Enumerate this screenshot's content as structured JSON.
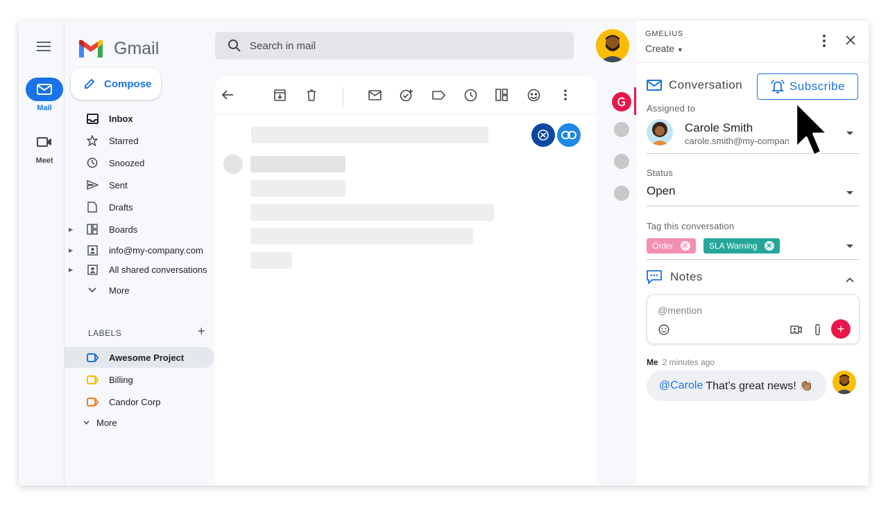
{
  "rail": {
    "mail_label": "Mail",
    "meet_label": "Meet"
  },
  "app": {
    "name": "Gmail",
    "compose_label": "Compose"
  },
  "search": {
    "placeholder": "Search in mail"
  },
  "nav": {
    "items": [
      {
        "label": "Inbox",
        "icon": "inbox-icon",
        "bold": true
      },
      {
        "label": "Starred",
        "icon": "star-icon"
      },
      {
        "label": "Snoozed",
        "icon": "clock-icon"
      },
      {
        "label": "Sent",
        "icon": "send-icon"
      },
      {
        "label": "Drafts",
        "icon": "draft-icon"
      },
      {
        "label": "Boards",
        "icon": "boards-icon"
      },
      {
        "label": "info@my-company.com",
        "icon": "shared-inbox-icon"
      },
      {
        "label": "All shared conversations",
        "icon": "shared-inbox-icon"
      },
      {
        "label": "More",
        "icon": "chevron-down-icon"
      }
    ],
    "labels_heading": "LABELS",
    "labels": [
      {
        "label": "Awesome Project",
        "color": "#1a73e8"
      },
      {
        "label": "Billing",
        "color": "#fbbc04"
      },
      {
        "label": "Candor Corp",
        "color": "#fa7b17"
      }
    ],
    "labels_more": "More"
  },
  "panel": {
    "brand": "GMELIUS",
    "create_label": "Create",
    "conversation_title": "Conversation",
    "subscribe_label": "Subscribe",
    "assigned_label": "Assigned to",
    "assignee_name": "Carole Smith",
    "assignee_email": "carole.smith@my-company.com",
    "status_label": "Status",
    "status_value": "Open",
    "tag_label": "Tag this conversation",
    "tags": [
      {
        "label": "Order",
        "color": "#f48fb1"
      },
      {
        "label": "SLA Warning",
        "color": "#26a69a"
      }
    ],
    "notes_title": "Notes",
    "notes_placeholder": "@mention",
    "message": {
      "author": "Me",
      "time": "2 minutes ago",
      "mention": "@Carole",
      "text": "That’s great news! 👏🏽"
    }
  },
  "colors": {
    "accent": "#1a73e8",
    "gmelius": "#e8174a"
  }
}
